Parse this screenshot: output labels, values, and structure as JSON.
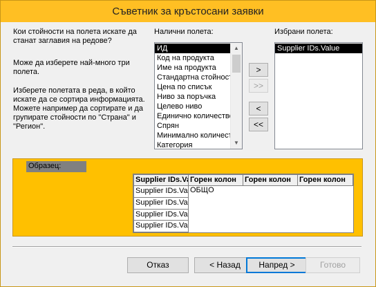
{
  "window": {
    "title": "Съветник за кръстосани заявки"
  },
  "instructions": {
    "question": "Кои стойности на полета искате да\nстанат заглавия на редове?",
    "hint": "Може да изберете най-много три\nполета.",
    "detail": "Изберете полетата в реда, в който\nискате да се сортира информацията.\nМожете например да сортирате и да\nгрупирате стойности по \"Страна\" и\n\"Регион\"."
  },
  "available": {
    "label": "Налични полета:",
    "items": [
      "ИД",
      "Код на продукта",
      "Име на продукта",
      "Стандартна стойност",
      "Цена по списък",
      "Ниво за поръчка",
      "Целево ниво",
      "Единично количество",
      "Спрян",
      "Минимално количество",
      "Категория"
    ],
    "selected_index": 0
  },
  "selected": {
    "label": "Избрани полета:",
    "items": [
      "Supplier IDs.Value"
    ]
  },
  "move_buttons": {
    "add_one": ">",
    "add_all": ">>",
    "remove_one": "<",
    "remove_all": "<<"
  },
  "sample": {
    "label": "Образец:",
    "row_header": "Supplier IDs.Value",
    "col_headers": [
      "Горен колон",
      "Горен колон",
      "Горен колон"
    ],
    "row_labels": [
      "Supplier IDs.Value",
      "Supplier IDs.Value",
      "Supplier IDs.Value",
      "Supplier IDs.Value"
    ],
    "total_label": "ОБЩО"
  },
  "footer": {
    "cancel": "Отказ",
    "back": "< Назад",
    "next": "Напред >",
    "finish": "Готово"
  }
}
